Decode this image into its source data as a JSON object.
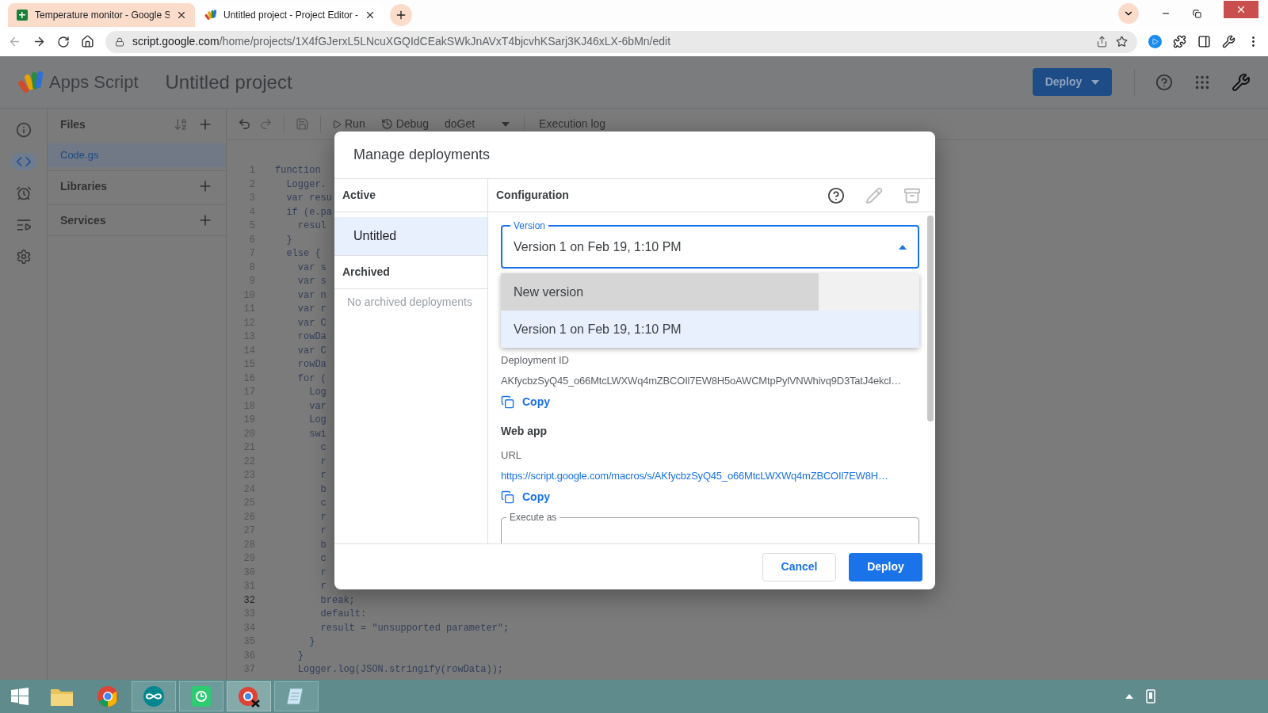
{
  "browser": {
    "tabs": [
      {
        "title": "Temperature monitor - Google S",
        "kind": "sheets",
        "selected": false
      },
      {
        "title": "Untitled project - Project Editor -",
        "kind": "appsscript",
        "selected": true
      }
    ],
    "url_host": "script.google.com",
    "url_path": "/home/projects/1X4fGJerxL5LNcuXGQIdCEakSWkJnAVxT4bjcvhKSarj3KJ46xLX-6bMn/edit"
  },
  "app": {
    "name": "Apps Script",
    "project": "Untitled project",
    "deploy_button": "Deploy"
  },
  "rail": [
    {
      "kind": "overview",
      "selected": false
    },
    {
      "kind": "editor",
      "selected": true
    },
    {
      "kind": "triggers",
      "selected": false
    },
    {
      "kind": "executions",
      "selected": false
    },
    {
      "kind": "settings",
      "selected": false
    }
  ],
  "files_panel": {
    "title": "Files",
    "files": [
      {
        "name": "Code.gs",
        "selected": true
      }
    ],
    "sections": [
      "Libraries",
      "Services"
    ]
  },
  "toolbar": {
    "run": "Run",
    "debug": "Debug",
    "function": "doGet",
    "log": "Execution log"
  },
  "code": {
    "lines": [
      {
        "number": "1",
        "text": "function",
        "current": false
      },
      {
        "number": "2",
        "text": "  Logger.",
        "current": false
      },
      {
        "number": "3",
        "text": "  var resu",
        "current": false
      },
      {
        "number": "4",
        "text": "  if (e.pa",
        "current": false
      },
      {
        "number": "5",
        "text": "    resul",
        "current": false
      },
      {
        "number": "6",
        "text": "  }",
        "current": false
      },
      {
        "number": "7",
        "text": "  else {",
        "current": false
      },
      {
        "number": "8",
        "text": "    var s",
        "current": false
      },
      {
        "number": "9",
        "text": "    var s",
        "current": false
      },
      {
        "number": "10",
        "text": "    var n",
        "current": false
      },
      {
        "number": "11",
        "text": "    var r",
        "current": false
      },
      {
        "number": "12",
        "text": "    var C",
        "current": false
      },
      {
        "number": "13",
        "text": "    rowDa",
        "current": false
      },
      {
        "number": "14",
        "text": "    var C",
        "current": false
      },
      {
        "number": "15",
        "text": "    rowDa",
        "current": false
      },
      {
        "number": "16",
        "text": "    for (",
        "current": false
      },
      {
        "number": "17",
        "text": "      Log",
        "current": false
      },
      {
        "number": "18",
        "text": "      var",
        "current": false
      },
      {
        "number": "19",
        "text": "      Log",
        "current": false
      },
      {
        "number": "20",
        "text": "      swi",
        "current": false
      },
      {
        "number": "21",
        "text": "        c",
        "current": false
      },
      {
        "number": "22",
        "text": "        r",
        "current": false
      },
      {
        "number": "23",
        "text": "        r",
        "current": false
      },
      {
        "number": "24",
        "text": "        b",
        "current": false
      },
      {
        "number": "25",
        "text": "        c",
        "current": false
      },
      {
        "number": "26",
        "text": "        r",
        "current": false
      },
      {
        "number": "27",
        "text": "        r",
        "current": false
      },
      {
        "number": "28",
        "text": "        b",
        "current": false
      },
      {
        "number": "29",
        "text": "        c",
        "current": false
      },
      {
        "number": "30",
        "text": "        r",
        "current": false
      },
      {
        "number": "31",
        "text": "        r",
        "current": false
      },
      {
        "number": "32",
        "text": "        break;",
        "current": true
      },
      {
        "number": "33",
        "text": "        default:",
        "current": false
      },
      {
        "number": "34",
        "text": "        result = \"unsupported parameter\";",
        "current": false
      },
      {
        "number": "35",
        "text": "      }",
        "current": false
      },
      {
        "number": "36",
        "text": "    }",
        "current": false
      },
      {
        "number": "37",
        "text": "    Logger.log(JSON.stringify(rowData));",
        "current": false
      }
    ]
  },
  "dialog": {
    "title": "Manage deployments",
    "active_header": "Active",
    "deployments": [
      {
        "name": "Untitled",
        "selected": true
      }
    ],
    "archived_header": "Archived",
    "archived_empty": "No archived deployments",
    "config_title": "Configuration",
    "config_actions": [
      {
        "kind": "help",
        "disabled": false
      },
      {
        "kind": "edit",
        "disabled": true
      },
      {
        "kind": "archive",
        "disabled": true
      }
    ],
    "version": {
      "label": "Version",
      "value": "Version 1 on Feb 19, 1:10 PM",
      "expanded": true,
      "options": [
        {
          "label": "New version",
          "hovered": true,
          "selected": false
        },
        {
          "label": "Version 1 on Feb 19, 1:10 PM",
          "hovered": false,
          "selected": true
        }
      ]
    },
    "deployment_id": {
      "label": "Deployment ID",
      "value": "AKfycbzSyQ45_o66MtcLWXWq4mZBCOIl7EW8H5oAWCMtpPylVNWhivq9D3TatJ4ekcl…",
      "copy": "Copy"
    },
    "web_app": {
      "title": "Web app",
      "url_label": "URL",
      "url": "https://script.google.com/macros/s/AKfycbzSyQ45_o66MtcLWXWq4mZBCOIl7EW8H…",
      "copy": "Copy"
    },
    "execute_as": {
      "label": "Execute as"
    },
    "buttons": [
      {
        "label": "Cancel",
        "kind": "outlined"
      },
      {
        "label": "Deploy",
        "kind": "filled"
      }
    ]
  }
}
